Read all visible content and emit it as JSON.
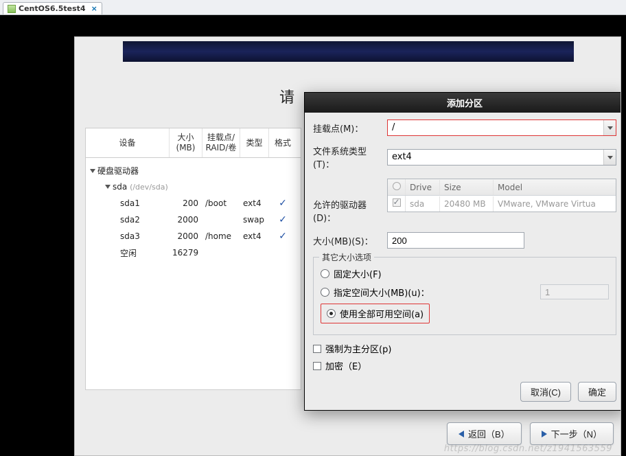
{
  "vm_tab": {
    "title": "CentOS6.5test4"
  },
  "installer": {
    "main_title": "请",
    "ptable": {
      "headers": {
        "device": "设备",
        "size": "大小\n(MB)",
        "mount": "挂载点/\nRAID/卷",
        "type": "类型",
        "format": "格式"
      },
      "hdd_group": "硬盘驱动器",
      "disk": {
        "name": "sda",
        "path": "(/dev/sda)"
      },
      "rows": [
        {
          "dev": "sda1",
          "size": "200",
          "mount": "/boot",
          "type": "ext4",
          "fmt": true
        },
        {
          "dev": "sda2",
          "size": "2000",
          "mount": "",
          "type": "swap",
          "fmt": true
        },
        {
          "dev": "sda3",
          "size": "2000",
          "mount": "/home",
          "type": "ext4",
          "fmt": true
        },
        {
          "dev": "空闲",
          "size": "16279",
          "mount": "",
          "type": "",
          "fmt": false
        }
      ]
    },
    "nav": {
      "back": "返回（B）",
      "next": "下一步（N）"
    }
  },
  "dialog": {
    "title": "添加分区",
    "labels": {
      "mount": "挂载点(M)：",
      "fstype": "文件系统类型(T)：",
      "drives": "允许的驱动器(D)：",
      "size": "大小(MB)(S)：",
      "other_group": "其它大小选项",
      "fixed": "固定大小(F)",
      "fillto": "指定空间大小(MB)(u)：",
      "fillall": "使用全部可用空间(a)",
      "primary": "强制为主分区(p)",
      "encrypt": "加密（E）",
      "cancel": "取消(C)",
      "ok": "确定"
    },
    "values": {
      "mount": "/",
      "fstype": "ext4",
      "size": "200",
      "fillto_val": "1"
    },
    "drive_table": {
      "headers": {
        "chk": "",
        "drive": "Drive",
        "size": "Size",
        "model": "Model"
      },
      "row": {
        "checked": true,
        "drive": "sda",
        "size": "20480 MB",
        "model": "VMware, VMware Virtua"
      }
    },
    "radio_selected": "fillall"
  },
  "watermark": "https://blog.csdn.net/z1941563559"
}
